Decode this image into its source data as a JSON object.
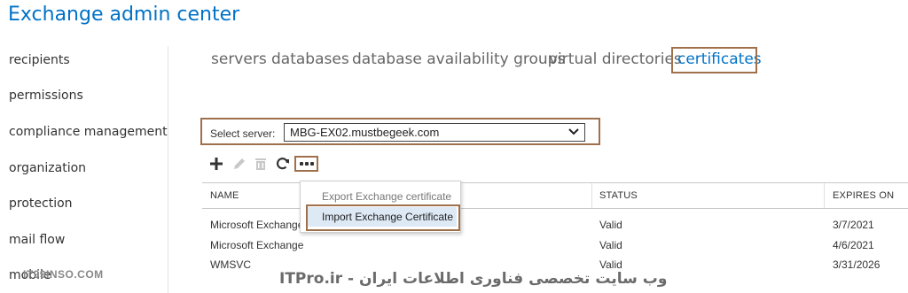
{
  "app": {
    "title": "Exchange admin center"
  },
  "sidebar": {
    "items": [
      {
        "label": "recipients"
      },
      {
        "label": "permissions"
      },
      {
        "label": "compliance management"
      },
      {
        "label": "organization"
      },
      {
        "label": "protection"
      },
      {
        "label": "mail flow"
      },
      {
        "label": "mobile"
      }
    ]
  },
  "tabs": [
    {
      "label": "servers"
    },
    {
      "label": "databases"
    },
    {
      "label": "database availability groups"
    },
    {
      "label": "virtual directories"
    },
    {
      "label": "certificates",
      "active": true
    }
  ],
  "server_picker": {
    "label": "Select server:",
    "value": "MBG-EX02.mustbegeek.com"
  },
  "toolbar": {
    "icons": [
      "add-icon",
      "edit-icon",
      "delete-icon",
      "refresh-icon",
      "more-icon"
    ]
  },
  "context_menu": {
    "items": [
      {
        "label": "Export Exchange certificate",
        "enabled": false
      },
      {
        "label": "Import Exchange Certificate",
        "enabled": true,
        "highlighted": true
      }
    ]
  },
  "table": {
    "columns": [
      "NAME",
      "STATUS",
      "EXPIRES ON"
    ],
    "rows": [
      {
        "name": "Microsoft Exchange",
        "status": "Valid",
        "expires": "3/7/2021"
      },
      {
        "name": "Microsoft Exchange",
        "status": "Valid",
        "expires": "4/6/2021"
      },
      {
        "name": "WMSVC",
        "status": "Valid",
        "expires": "3/31/2026"
      }
    ]
  },
  "watermark": {
    "left": "IT99INSO.COM",
    "right": "ITPro.ir - وب سایت تخصصی فناوری اطلاعات ایران"
  },
  "colors": {
    "accent": "#0072c6",
    "highlight_box": "#a0704b"
  }
}
